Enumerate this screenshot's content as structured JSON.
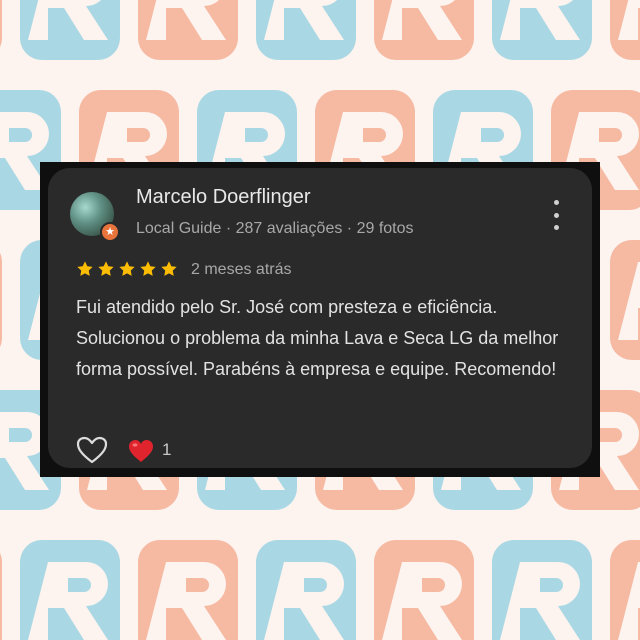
{
  "background": {
    "colors": {
      "base": "#fdf3ef",
      "blue": "#a9d8e4",
      "orange": "#f6b9a2"
    },
    "pattern_icon": "wrench-logo-icon"
  },
  "review": {
    "author": {
      "name": "Marcelo Doerflinger",
      "meta": "Local Guide · 287 avaliações · 29 fotos",
      "avatar_icon": "avatar-photo",
      "badge_icon": "local-guide-star-icon"
    },
    "more_icon": "more-vertical-icon",
    "rating": {
      "stars": 5,
      "max": 5,
      "star_color": "#fbbc04"
    },
    "date": "2 meses atrás",
    "text": "Fui atendido pelo Sr. José com presteza e eficiência. Solucionou o problema da minha Lava e Seca LG da melhor forma possível. Parabéns à empresa e equipe. Recomendo!",
    "reactions": {
      "like_icon": "heart-outline-icon",
      "love_icon": "red-heart-emoji-icon",
      "love_count": "1"
    },
    "colors": {
      "card": "#2a2a2b",
      "frame": "#0f0f0f",
      "text": "#e2e2e2",
      "muted": "#a8a8a8"
    }
  }
}
